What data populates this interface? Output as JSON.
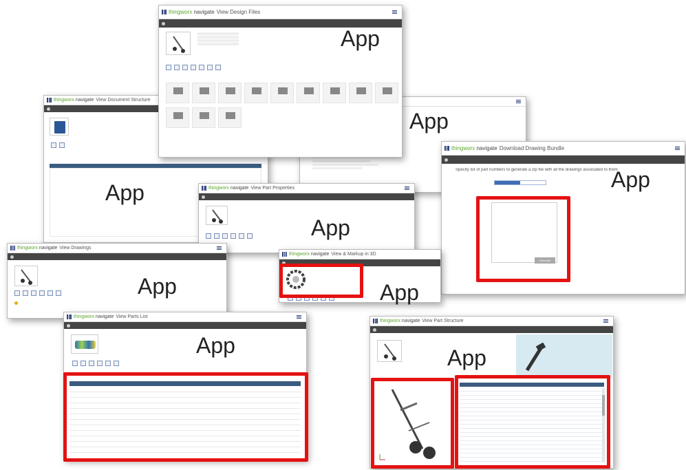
{
  "overlay_label": "App",
  "windows": {
    "document_structure": {
      "brand": "thingworx",
      "brand_app": "navigate",
      "title": "View Document Structure",
      "label": "App"
    },
    "design_files": {
      "brand": "thingworx",
      "brand_app": "navigate",
      "title": "View Design Files",
      "label": "App"
    },
    "part_properties": {
      "brand": "thingworx",
      "brand_app": "navigate",
      "title": "View Part Properties",
      "label": "App"
    },
    "drawing_bundle": {
      "brand": "thingworx",
      "brand_app": "navigate",
      "title": "Download Drawing Bundle",
      "label": "App",
      "instruction": "Specify list of part numbers to generate a zip file with all the drawings associated to them",
      "generate_label": "Generate"
    },
    "drawings": {
      "brand": "thingworx",
      "brand_app": "navigate",
      "title": "View Drawings",
      "label": "App"
    },
    "view_markups": {
      "brand": "thingworx",
      "brand_app": "navigate",
      "title": "View & Markup in 3D",
      "label": "App"
    },
    "parts_list": {
      "brand": "thingworx",
      "brand_app": "navigate",
      "title": "View Parts List",
      "label": "App"
    },
    "part_structure": {
      "brand": "thingworx",
      "brand_app": "navigate",
      "title": "View Part Structure",
      "label": "App"
    },
    "background_window": {
      "label": "App"
    }
  },
  "colors": {
    "accent": "#5aa52a",
    "highlight": "#e41212",
    "table_header": "#3b5c80",
    "dark_bar": "#454545"
  }
}
